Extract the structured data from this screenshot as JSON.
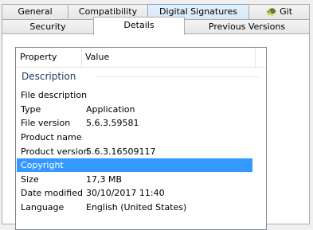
{
  "tabs_back": [
    "General",
    "Compatibility",
    "Digital Signatures",
    "Git"
  ],
  "tabs_front": [
    "Security",
    "Details",
    "Previous Versions"
  ],
  "git_icon": "git-tortoise-icon",
  "active_tab": "Details",
  "hover_tab": "Digital Signatures",
  "list": {
    "columns": [
      "Property",
      "Value"
    ],
    "group": "Description",
    "rows": [
      {
        "property": "File description",
        "value": ""
      },
      {
        "property": "Type",
        "value": "Application"
      },
      {
        "property": "File version",
        "value": "5.6.3.59581"
      },
      {
        "property": "Product name",
        "value": ""
      },
      {
        "property": "Product version",
        "value": "5.6.3.16509117"
      },
      {
        "property": "Copyright",
        "value": "",
        "selected": true
      },
      {
        "property": "Size",
        "value": "17,3 MB"
      },
      {
        "property": "Date modified",
        "value": "30/10/2017 11:40"
      },
      {
        "property": "Language",
        "value": "English (United States)"
      }
    ]
  },
  "colors": {
    "selection": "#3399ff",
    "group_text": "#1e395b",
    "hover_tab": "#d6e8f8"
  }
}
